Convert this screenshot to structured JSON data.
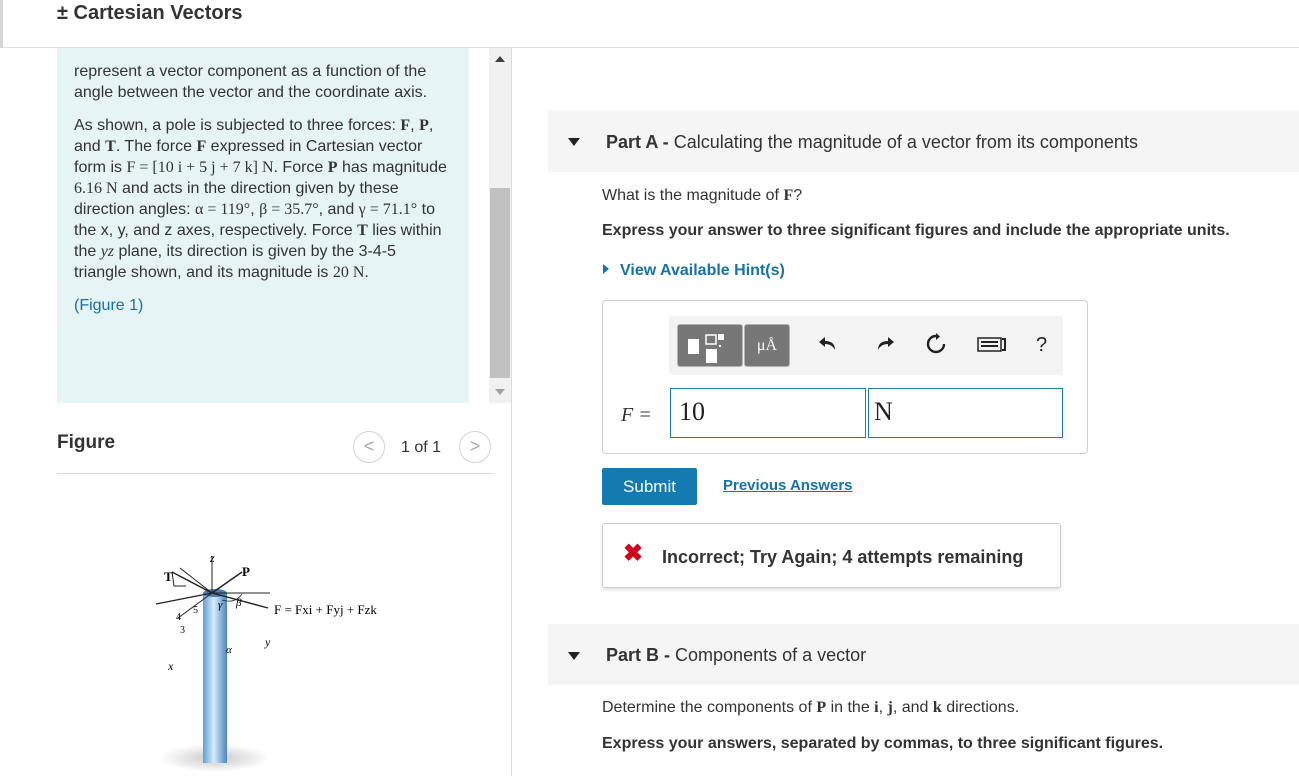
{
  "header": {
    "title": "± Cartesian Vectors"
  },
  "intro": {
    "lead_text": "represent a vector component as a function of the angle between the vector and the coordinate axis.",
    "p2_a": "As shown, a pole is subjected to three forces: ",
    "p2_F": "F",
    "p2_sep1": ", ",
    "p2_P": "P",
    "p2_sep2": ", and ",
    "p2_T": "T",
    "p2_b": ". The force ",
    "p2_F2": "F",
    "p2_c": " expressed in Cartesian vector form is ",
    "p2_Fvec": "F = [10 i + 5 j + 7 k] N",
    "p2_d": ". Force ",
    "p2_P2": "P",
    "p2_e": " has magnitude ",
    "p2_Pmag": "6.16 N",
    "p2_f": " and acts in the direction given by these direction angles: ",
    "p2_alpha": "α = 119°",
    "p2_g": ", ",
    "p2_beta": "β = 35.7°",
    "p2_h": ", and ",
    "p2_gamma": "γ = 71.1°",
    "p2_i": " to the x, y, and z axes, respectively. Force ",
    "p2_T2": "T",
    "p2_j": " lies within the ",
    "p2_yz": "yz",
    "p2_k": " plane, its direction is given by the 3-4-5 triangle shown, and its magnitude is ",
    "p2_Tmag": "20 N",
    "p2_l": ".",
    "figure_link": "(Figure 1)"
  },
  "figure_nav": {
    "heading": "Figure",
    "prev": "<",
    "counter": "1 of 1",
    "next": ">"
  },
  "figure": {
    "label_z": "z",
    "label_T": "T",
    "label_P": "P",
    "label_5": "5",
    "label_4": "4",
    "label_3": "3",
    "label_gamma": "γ",
    "label_beta": "β",
    "label_alpha": "α",
    "label_y": "y",
    "label_x": "x",
    "equation": "F = Fxi + Fyj + Fzk"
  },
  "part_a": {
    "label": "Part A -",
    "title": "Calculating the magnitude of a vector from its components",
    "question_a": "What is the magnitude of ",
    "question_F": "F",
    "question_b": "?",
    "instruction": "Express your answer to three significant figures and include the appropriate units.",
    "hint_link": "View Available Hint(s)",
    "toolbar": {
      "units_label": "μÅ",
      "undo_icon": "undo-icon",
      "redo_icon": "redo-icon",
      "reset_icon": "reset-icon",
      "keyboard_icon": "keyboard-icon",
      "help_label": "?"
    },
    "variable_label": "F =",
    "value": "10",
    "unit": "N",
    "submit_label": "Submit",
    "previous_answers_label": "Previous Answers",
    "feedback": "Incorrect; Try Again; 4 attempts remaining",
    "feedback_icon": "✖"
  },
  "part_b": {
    "label": "Part B -",
    "title": "Components of a vector",
    "question_a": "Determine the components of ",
    "question_P": "P",
    "question_b": " in the ",
    "question_i": "i",
    "question_c": ", ",
    "question_j": "j",
    "question_d": ", and ",
    "question_k": "k",
    "question_e": " directions.",
    "instruction": "Express your answers, separated by commas, to three significant figures."
  },
  "colors": {
    "accent": "#137bb0",
    "link": "#1672a7",
    "intro_bg": "#e6f4f6",
    "error": "#d0021b"
  }
}
